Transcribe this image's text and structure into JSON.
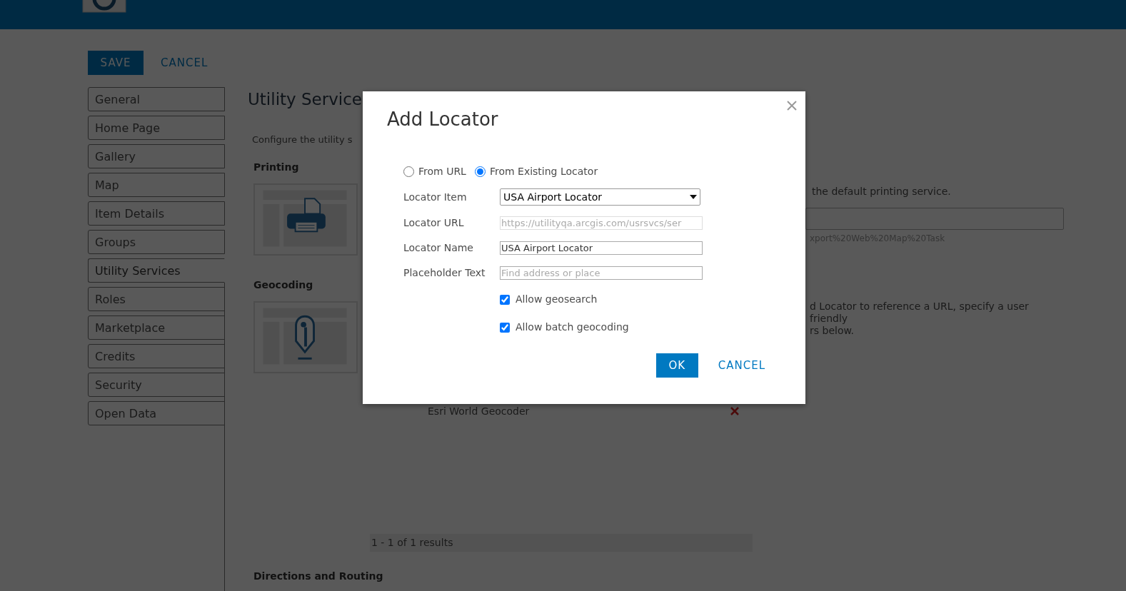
{
  "actions": [
    {
      "label": "SAVE",
      "kind": "primary"
    },
    {
      "label": "CANCEL",
      "kind": "link"
    }
  ],
  "sidebar": {
    "items": [
      {
        "label": "General",
        "selected": false
      },
      {
        "label": "Home Page",
        "selected": false
      },
      {
        "label": "Gallery",
        "selected": false
      },
      {
        "label": "Map",
        "selected": false
      },
      {
        "label": "Item Details",
        "selected": false
      },
      {
        "label": "Groups",
        "selected": false
      },
      {
        "label": "Utility Services",
        "selected": true
      },
      {
        "label": "Roles",
        "selected": false
      },
      {
        "label": "Marketplace",
        "selected": false
      },
      {
        "label": "Credits",
        "selected": false
      },
      {
        "label": "Security",
        "selected": false
      },
      {
        "label": "Open Data",
        "selected": false
      }
    ]
  },
  "content": {
    "title": "Utility Service",
    "intro": "Configure the utility s",
    "printing": {
      "heading": "Printing",
      "description": "the default printing service.",
      "url_hint": "xport%20Web%20Map%20Task"
    },
    "geocoding": {
      "heading": "Geocoding",
      "description": [
        "d Locator to reference a URL, specify a user friendly",
        "rs below."
      ],
      "locators": [
        {
          "name": "Esri World Geocoder"
        }
      ],
      "results": "1 - 1 of 1 results"
    },
    "directions": {
      "heading": "Directions and Routing"
    }
  },
  "dialog": {
    "title": "Add Locator",
    "source_options": [
      {
        "label": "From URL",
        "selected": false
      },
      {
        "label": "From Existing Locator",
        "selected": true
      }
    ],
    "fields": [
      {
        "label": "Locator Item",
        "kind": "select",
        "value": "USA Airport Locator"
      },
      {
        "label": "Locator URL",
        "kind": "input",
        "value": "https://utilityqa.arcgis.com/usrsvcs/ser",
        "disabled": true
      },
      {
        "label": "Locator Name",
        "kind": "input",
        "value": "USA Airport Locator",
        "disabled": false
      },
      {
        "label": "Placeholder Text",
        "kind": "input",
        "placeholder": "Find address or place",
        "disabled": false
      }
    ],
    "checkboxes": [
      {
        "label": "Allow geosearch",
        "checked": true
      },
      {
        "label": "Allow batch geocoding",
        "checked": true
      }
    ],
    "buttons": [
      {
        "label": "OK",
        "kind": "primary"
      },
      {
        "label": "CANCEL",
        "kind": "link"
      }
    ]
  }
}
